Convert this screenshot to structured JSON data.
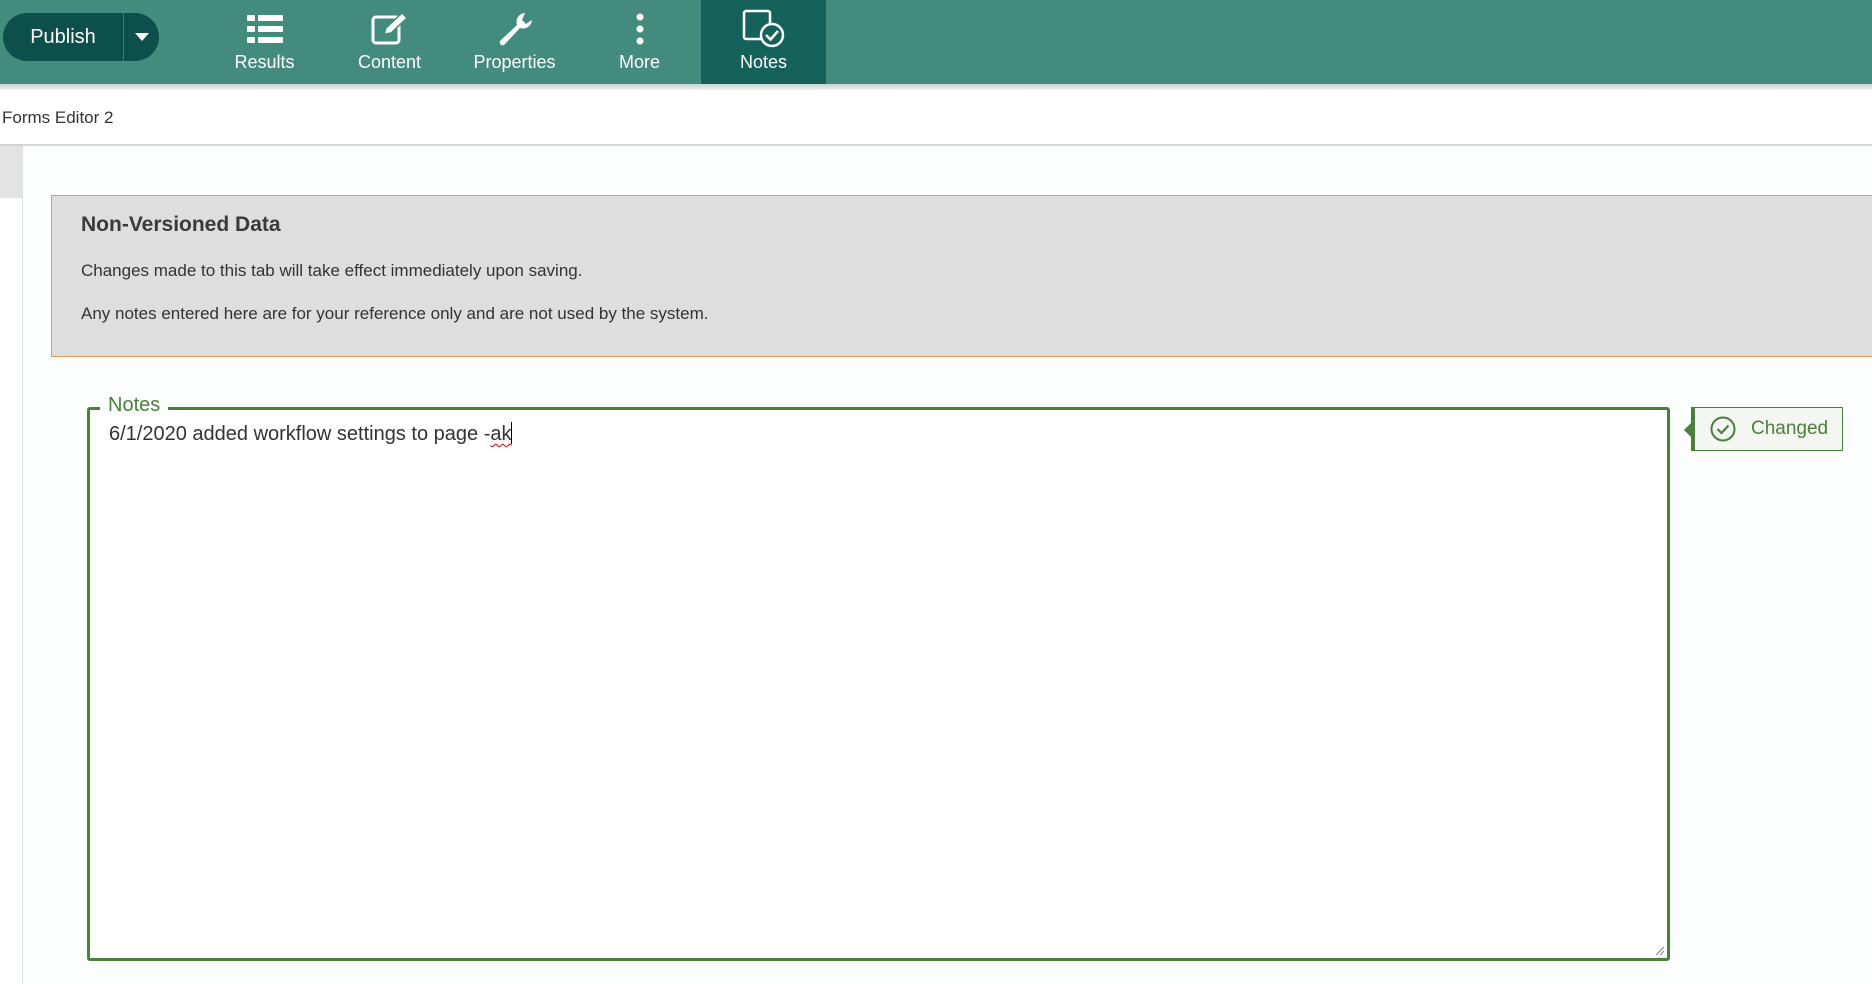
{
  "toolbar": {
    "publish_label": "Publish",
    "items": [
      {
        "label": "Results",
        "icon": "list-icon"
      },
      {
        "label": "Content",
        "icon": "edit-icon"
      },
      {
        "label": "Properties",
        "icon": "wrench-icon"
      },
      {
        "label": "More",
        "icon": "more-vertical-icon"
      },
      {
        "label": "Notes",
        "icon": "notes-check-icon",
        "active": true
      }
    ]
  },
  "breadcrumb": "Forms Editor 2",
  "notice": {
    "title": "Non-Versioned Data",
    "line1": "Changes made to this tab will take effect immediately upon saving.",
    "line2": "Any notes entered here are for your reference only and are not used by the system."
  },
  "notes": {
    "legend": "Notes",
    "value_main": "6/1/2020 added workflow settings to page -",
    "value_misspelled": "ak"
  },
  "status": {
    "label": "Changed",
    "icon": "check-circle-icon"
  },
  "colors": {
    "toolbar": "#438b7d",
    "toolbar_active": "#15625a",
    "publish": "#0d4f4a",
    "notice_border": "#e49a5a",
    "field_border": "#4a7f3c"
  }
}
